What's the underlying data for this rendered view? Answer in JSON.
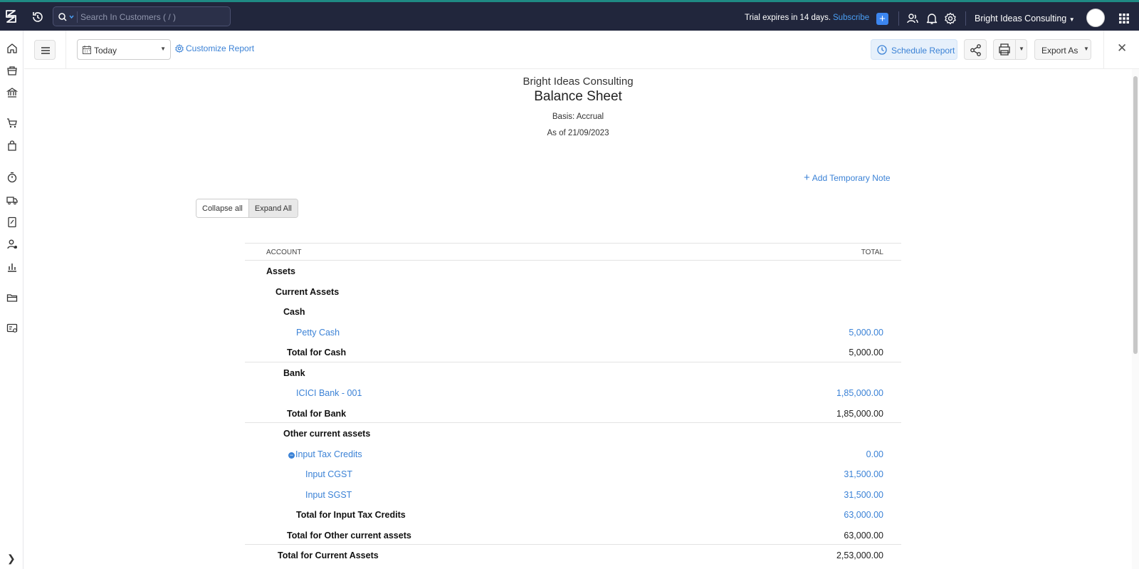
{
  "topbar": {
    "search_placeholder": "Search In Customers ( / )",
    "trial_text": "Trial expires in 14 days.",
    "subscribe_label": "Subscribe",
    "org_name": "Bright Ideas Consulting"
  },
  "toolbar": {
    "date_value": "Today",
    "customize_label": "Customize Report",
    "schedule_label": "Schedule Report",
    "export_label": "Export As"
  },
  "report": {
    "org": "Bright Ideas Consulting",
    "title": "Balance Sheet",
    "basis": "Basis: Accrual",
    "as_of": "As of 21/09/2023",
    "add_note_label": "Add Temporary Note",
    "collapse_label": "Collapse all",
    "expand_label": "Expand All",
    "col_account": "ACCOUNT",
    "col_total": "TOTAL",
    "rows": [
      {
        "label": "Assets",
        "amount": ""
      },
      {
        "label": "Current Assets",
        "amount": ""
      },
      {
        "label": "Cash",
        "amount": ""
      },
      {
        "label": "Petty Cash",
        "amount": "5,000.00"
      },
      {
        "label": "Total for Cash",
        "amount": "5,000.00"
      },
      {
        "label": "Bank",
        "amount": ""
      },
      {
        "label": "ICICI Bank - 001",
        "amount": "1,85,000.00"
      },
      {
        "label": "Total for Bank",
        "amount": "1,85,000.00"
      },
      {
        "label": "Other current assets",
        "amount": ""
      },
      {
        "label": "Input Tax Credits",
        "amount": "0.00"
      },
      {
        "label": "Input CGST",
        "amount": "31,500.00"
      },
      {
        "label": "Input SGST",
        "amount": "31,500.00"
      },
      {
        "label": "Total for Input Tax Credits",
        "amount": "63,000.00"
      },
      {
        "label": "Total for Other current assets",
        "amount": "63,000.00"
      },
      {
        "label": "Total for Current Assets",
        "amount": "2,53,000.00"
      }
    ]
  },
  "colors": {
    "topbar_bg": "#21263c",
    "accent": "#3b82d6",
    "top_border": "#1f8a84"
  }
}
